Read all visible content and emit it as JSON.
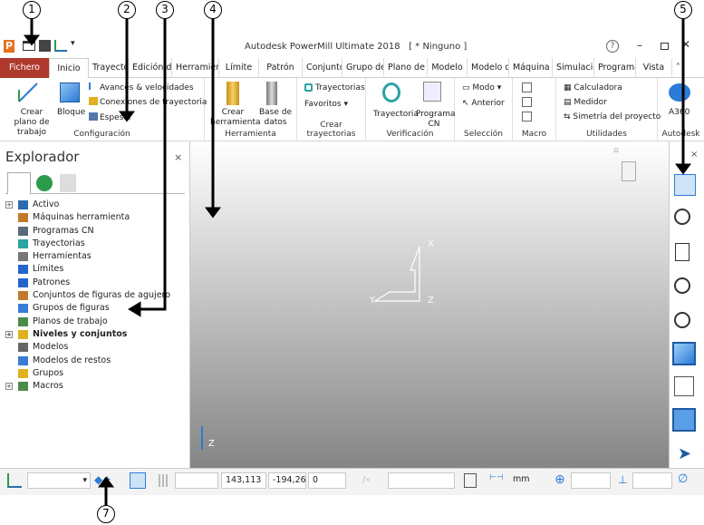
{
  "window": {
    "title": "Autodesk PowerMill Ultimate 2018",
    "document": "[ * Ninguno ]"
  },
  "tabs": [
    {
      "label": "Fichero"
    },
    {
      "label": "Inicio"
    },
    {
      "label": "Trayectorias"
    },
    {
      "label": "Edición de"
    },
    {
      "label": "Herramienta"
    },
    {
      "label": "Límite"
    },
    {
      "label": "Patrón"
    },
    {
      "label": "Conjunto"
    },
    {
      "label": "Grupo de"
    },
    {
      "label": "Plano de t"
    },
    {
      "label": "Modelo"
    },
    {
      "label": "Modelo d"
    },
    {
      "label": "Máquina h"
    },
    {
      "label": "Simulación"
    },
    {
      "label": "Programa"
    },
    {
      "label": "Vista"
    }
  ],
  "ribbon": {
    "config": {
      "label": "Configuración",
      "plano": "Crear plano de trabajo",
      "bloque": "Bloque",
      "avances": "Avances & velocidades",
      "conexiones": "Conexiones de trayectoria",
      "espesor": "Espesor"
    },
    "herramienta": {
      "label": "Herramienta",
      "crear": "Crear herramienta",
      "base": "Base de datos"
    },
    "crear_tray": {
      "label": "Crear trayectorias",
      "trayectorias": "Trayectorias",
      "favoritos": "Favoritos"
    },
    "verificacion": {
      "label": "Verificación",
      "trayectoria": "Trayectoria",
      "programa": "Programa CN"
    },
    "seleccion": {
      "label": "Selección",
      "modo": "Modo",
      "anterior": "Anterior"
    },
    "macro": {
      "label": "Macro"
    },
    "utilidades": {
      "label": "Utilidades",
      "calc": "Calculadora",
      "medidor": "Medidor",
      "simetria": "Simetría del proyecto"
    },
    "a360": {
      "label": "Autodesk",
      "name": "A360"
    }
  },
  "explorer": {
    "title": "Explorador",
    "items": [
      {
        "label": "Activo",
        "color": "#2b6cb0",
        "expand": "+"
      },
      {
        "label": "Máquinas herramienta",
        "color": "#c07a2a"
      },
      {
        "label": "Programas CN",
        "color": "#5a6b7b"
      },
      {
        "label": "Trayectorias",
        "color": "#2aa3a3"
      },
      {
        "label": "Herramientas",
        "color": "#777777"
      },
      {
        "label": "Límites",
        "color": "#2266cc"
      },
      {
        "label": "Patrones",
        "color": "#2266cc"
      },
      {
        "label": "Conjuntos de figuras de agujero",
        "color": "#c07a2a"
      },
      {
        "label": "Grupos de figuras",
        "color": "#3a7bd5"
      },
      {
        "label": "Planos de trabajo",
        "color": "#4a8c4a"
      },
      {
        "label": "Niveles y conjuntos",
        "color": "#e0b020",
        "expand": "+",
        "bold": true
      },
      {
        "label": "Modelos",
        "color": "#666666"
      },
      {
        "label": "Modelos de restos",
        "color": "#3a7bd5"
      },
      {
        "label": "Grupos",
        "color": "#e0b020"
      },
      {
        "label": "Macros",
        "color": "#4a8c4a",
        "expand": "+"
      }
    ]
  },
  "viewport": {
    "axis_x": "X",
    "axis_y": "Y",
    "axis_z": "Z"
  },
  "status": {
    "coord_x": "143,113",
    "coord_y": "-194,26",
    "coord_z": "0",
    "units": "mm"
  },
  "callouts": [
    "1",
    "2",
    "3",
    "4",
    "5",
    "7"
  ],
  "colors": {
    "file_tab": "#b0392e",
    "accent": "#2b7bd8"
  }
}
